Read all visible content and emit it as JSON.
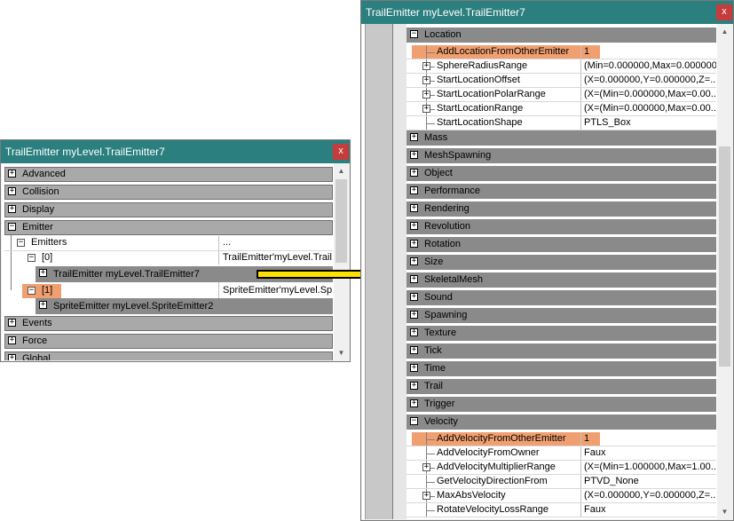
{
  "left_window": {
    "title": "TrailEmitter myLevel.TrailEmitter7",
    "close": "x",
    "categories_top": [
      "Advanced",
      "Collision",
      "Display",
      "Emitter"
    ],
    "emitter_rows": [
      {
        "label": "Emitters",
        "value": "..."
      },
      {
        "label": "[0]",
        "value": "TrailEmitter'myLevel.Trail..."
      },
      {
        "label": "TrailEmitter myLevel.TrailEmitter7"
      },
      {
        "label": "[1]",
        "value": "SpriteEmitter'myLevel.Sp..."
      },
      {
        "label": "SpriteEmitter myLevel.SpriteEmitter2"
      }
    ],
    "categories_bottom": [
      "Events",
      "Force",
      "Global"
    ]
  },
  "right_window": {
    "title": "TrailEmitter myLevel.TrailEmitter7",
    "close": "x",
    "location": {
      "label": "Location",
      "rows": [
        {
          "name": "AddLocationFromOtherEmitter",
          "value": "1",
          "highlight": true
        },
        {
          "name": "SphereRadiusRange",
          "value": "(Min=0.000000,Max=0.000000)"
        },
        {
          "name": "StartLocationOffset",
          "value": "(X=0.000000,Y=0.000000,Z=..."
        },
        {
          "name": "StartLocationPolarRange",
          "value": "(X=(Min=0.000000,Max=0.00..."
        },
        {
          "name": "StartLocationRange",
          "value": "(X=(Min=0.000000,Max=0.00..."
        },
        {
          "name": "StartLocationShape",
          "value": "PTLS_Box"
        }
      ]
    },
    "categories": [
      "Mass",
      "MeshSpawning",
      "Object",
      "Performance",
      "Rendering",
      "Revolution",
      "Rotation",
      "Size",
      "SkeletalMesh",
      "Sound",
      "Spawning",
      "Texture",
      "Tick",
      "Time",
      "Trail",
      "Trigger"
    ],
    "velocity": {
      "label": "Velocity",
      "rows": [
        {
          "name": "AddVelocityFromOtherEmitter",
          "value": "1",
          "highlight": true
        },
        {
          "name": "AddVelocityFromOwner",
          "value": "Faux"
        },
        {
          "name": "AddVelocityMultiplierRange",
          "value": "(X=(Min=1.000000,Max=1.00..."
        },
        {
          "name": "GetVelocityDirectionFrom",
          "value": "PTVD_None"
        },
        {
          "name": "MaxAbsVelocity",
          "value": "(X=0.000000,Y=0.000000,Z=..."
        },
        {
          "name": "RotateVelocityLossRange",
          "value": "Faux"
        }
      ]
    }
  }
}
